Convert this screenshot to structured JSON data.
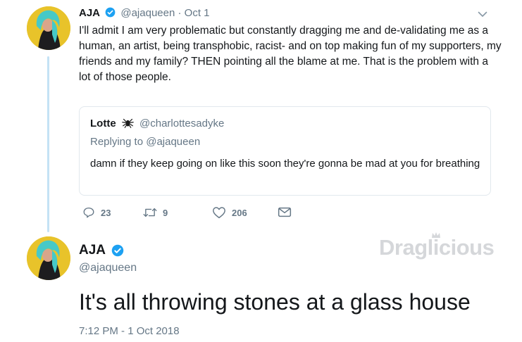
{
  "tweet1": {
    "name": "AJA",
    "handle": "@ajaqueen",
    "separator": "·",
    "date": "Oct 1",
    "text": "I'll admit I am very problematic but constantly dragging me and de-validating me as a human, an artist, being transphobic, racist- and on top making fun of my supporters, my friends and my family? THEN pointing all the blame at me. That is the problem with a lot of those people."
  },
  "quote": {
    "name": "Lotte",
    "handle": "@charlottesadyke",
    "reply_prefix": "Replying to",
    "reply_mention": "@ajaqueen",
    "text": "damn if they keep going on like this soon they're gonna be mad at you for breathing"
  },
  "actions": {
    "replies": "23",
    "retweets": "9",
    "likes": "206"
  },
  "tweet2": {
    "name": "AJA",
    "handle": "@ajaqueen",
    "text": "It's all throwing stones at a glass house",
    "timestamp": "7:12 PM - 1 Oct 2018"
  },
  "watermark": "Draglicious",
  "icons": {
    "verified": "verified-badge-icon",
    "caret": "chevron-down-icon",
    "spider": "spider-emoji-icon",
    "reply": "reply-icon",
    "retweet": "retweet-icon",
    "like": "heart-icon",
    "dm": "envelope-icon"
  },
  "colors": {
    "verified_blue": "#1da1f2",
    "thread_line": "#c4e2f5",
    "secondary_text": "#657786",
    "avatar_bg": "#e8c32a"
  }
}
